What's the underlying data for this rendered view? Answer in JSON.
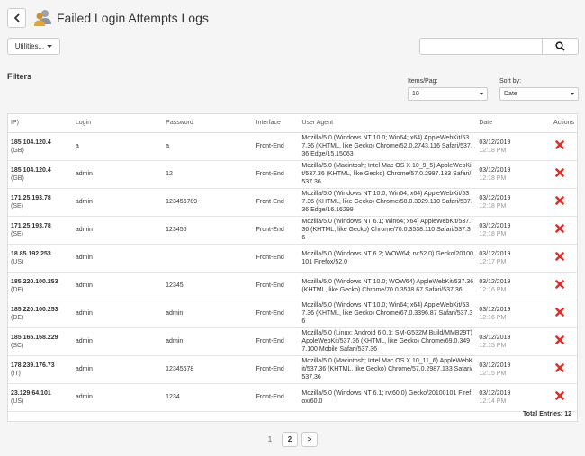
{
  "header": {
    "title": "Failed Login Attempts Logs"
  },
  "toolbar": {
    "utilities_label": "Utilities...",
    "search_value": ""
  },
  "filters": {
    "title": "Filters",
    "items_per_page_label": "Items/Pag:",
    "items_per_page_value": "10",
    "sort_by_label": "Sort by:",
    "sort_by_value": "Date"
  },
  "table": {
    "headers": {
      "ip": "IP)",
      "login": "Login",
      "password": "Password",
      "interface": "Interface",
      "user_agent": "User Agent",
      "date": "Date",
      "actions": "Actions"
    },
    "rows": [
      {
        "ip": "185.104.120.4",
        "cc": "(GB)",
        "login": "a",
        "password": "a",
        "interface": "Front-End",
        "ua": "Mozilla/5.0 (Windows NT 10.0; Win64; x64) AppleWebKit/537.36 (KHTML, like Gecko) Chrome/52.0.2743.116 Safari/537.36 Edge/15.15063",
        "date": "03/12/2019",
        "time": "12:18 PM"
      },
      {
        "ip": "185.104.120.4",
        "cc": "(GB)",
        "login": "admin",
        "password": "12",
        "interface": "Front-End",
        "ua": "Mozilla/5.0 (Macintosh; Intel Mac OS X 10_9_5) AppleWebKit/537.36 (KHTML, like Gecko) Chrome/57.0.2987.133 Safari/537.36",
        "date": "03/12/2019",
        "time": "12:18 PM"
      },
      {
        "ip": "171.25.193.78",
        "cc": "(SE)",
        "login": "admin",
        "password": "123456789",
        "interface": "Front-End",
        "ua": "Mozilla/5.0 (Windows NT 10.0; Win64; x64) AppleWebKit/537.36 (KHTML, like Gecko) Chrome/58.0.3029.110 Safari/537.36 Edge/16.16299",
        "date": "03/12/2019",
        "time": "12:18 PM"
      },
      {
        "ip": "171.25.193.78",
        "cc": "(SE)",
        "login": "admin",
        "password": "123456",
        "interface": "Front-End",
        "ua": "Mozilla/5.0 (Windows NT 6.1; Win64; x64) AppleWebKit/537.36 (KHTML, like Gecko) Chrome/70.0.3538.110 Safari/537.36",
        "date": "03/12/2019",
        "time": "12:18 PM"
      },
      {
        "ip": "18.85.192.253",
        "cc": "(US)",
        "login": "admin",
        "password": "",
        "interface": "Front-End",
        "ua": "Mozilla/5.0 (Windows NT 6.2; WOW64; rv:52.0) Gecko/20100101 Firefox/52.0",
        "date": "03/12/2019",
        "time": "12:17 PM"
      },
      {
        "ip": "185.220.100.253",
        "cc": "(DE)",
        "login": "admin",
        "password": "12345",
        "interface": "Front-End",
        "ua": "Mozilla/5.0 (Windows NT 10.0; WOW64) AppleWebKit/537.36 (KHTML, like Gecko) Chrome/70.0.3538.67 Safari/537.36",
        "date": "03/12/2019",
        "time": "12:16 PM"
      },
      {
        "ip": "185.220.100.253",
        "cc": "(DE)",
        "login": "admin",
        "password": "admin",
        "interface": "Front-End",
        "ua": "Mozilla/5.0 (Windows NT 10.0; Win64; x64) AppleWebKit/537.36 (KHTML, like Gecko) Chrome/67.0.3396.87 Safari/537.36",
        "date": "03/12/2019",
        "time": "12:16 PM"
      },
      {
        "ip": "185.165.168.229",
        "cc": "(SC)",
        "login": "admin",
        "password": "admin",
        "interface": "Front-End",
        "ua": "Mozilla/5.0 (Linux; Android 6.0.1; SM-G532M Build/MMB29T) AppleWebKit/537.36 (KHTML, like Gecko) Chrome/69.0.3497.100 Mobile Safari/537.36",
        "date": "03/12/2019",
        "time": "12:15 PM"
      },
      {
        "ip": "178.239.176.73",
        "cc": "(IT)",
        "login": "admin",
        "password": "12345678",
        "interface": "Front-End",
        "ua": "Mozilla/5.0 (Macintosh; Intel Mac OS X 10_11_6) AppleWebKit/537.36 (KHTML, like Gecko) Chrome/57.0.2987.133 Safari/537.36",
        "date": "03/12/2019",
        "time": "12:15 PM"
      },
      {
        "ip": "23.129.64.101",
        "cc": "(US)",
        "login": "admin",
        "password": "1234",
        "interface": "Front-End",
        "ua": "Mozilla/5.0 (Windows NT 6.1; rv:60.0) Gecko/20100101 Firefox/60.0",
        "date": "03/12/2019",
        "time": "12:14 PM"
      }
    ],
    "total_label": "Total Entries: 12"
  },
  "pagination": {
    "page1": "1",
    "page2": "2",
    "next": ">"
  },
  "colors": {
    "delete": "#d9302c",
    "icon_gray": "#888888"
  }
}
